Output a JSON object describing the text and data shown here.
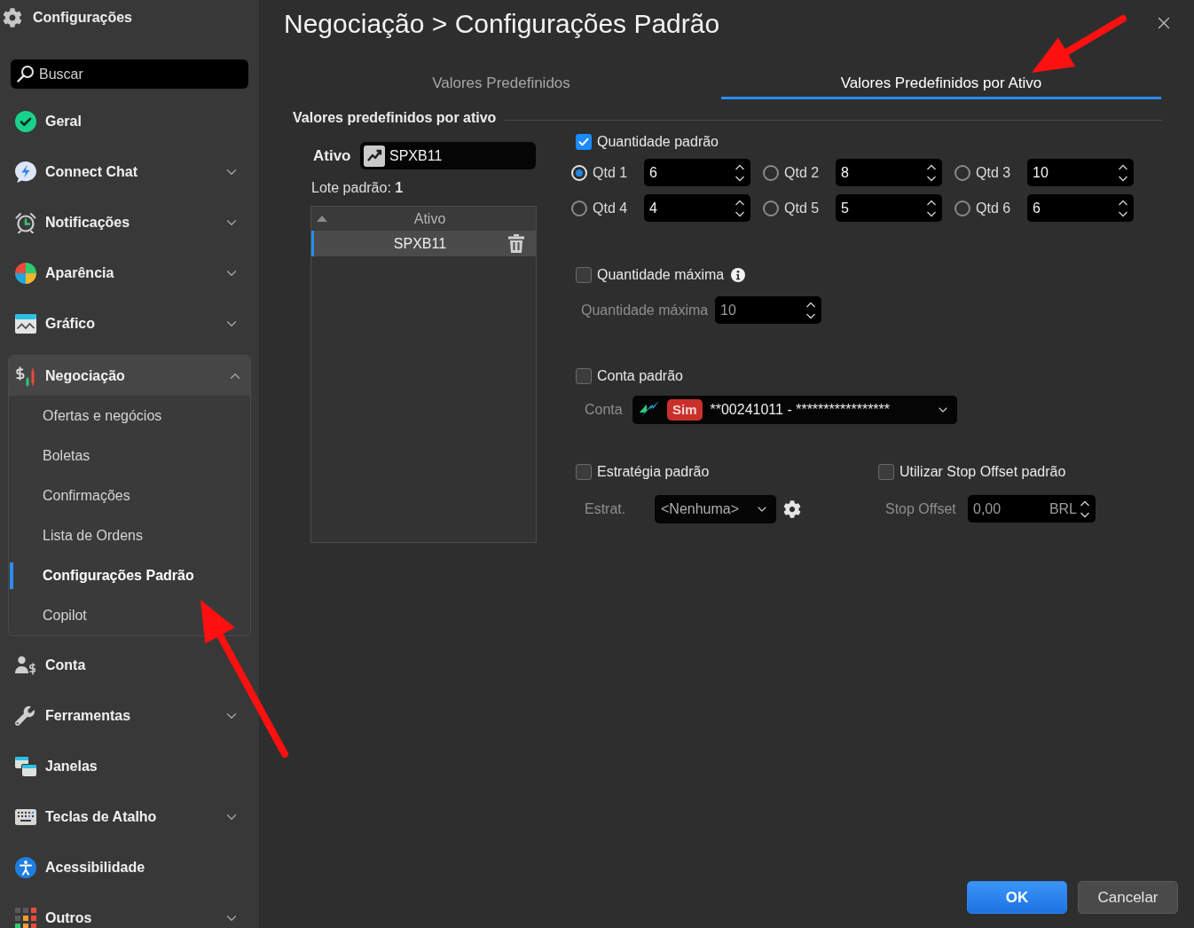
{
  "sidebar": {
    "title": "Configurações",
    "search": {
      "placeholder": "Buscar"
    },
    "items": [
      {
        "label": "Geral",
        "kind": "page",
        "selected": false
      },
      {
        "label": "Connect Chat",
        "kind": "group",
        "expanded": false,
        "selected": false
      },
      {
        "label": "Notificações",
        "kind": "group",
        "expanded": false,
        "selected": false
      },
      {
        "label": "Aparência",
        "kind": "group",
        "expanded": false,
        "selected": false
      },
      {
        "label": "Gráfico",
        "kind": "group",
        "expanded": false,
        "selected": false
      },
      {
        "label": "Negociação",
        "kind": "group",
        "expanded": true,
        "selected": false,
        "children": [
          {
            "label": "Ofertas e negócios",
            "selected": false
          },
          {
            "label": "Boletas",
            "selected": false
          },
          {
            "label": "Confirmações",
            "selected": false
          },
          {
            "label": "Lista de Ordens",
            "selected": false
          },
          {
            "label": "Configurações Padrão",
            "selected": true
          },
          {
            "label": "Copilot",
            "selected": false
          }
        ]
      },
      {
        "label": "Conta",
        "kind": "page",
        "selected": false
      },
      {
        "label": "Ferramentas",
        "kind": "group",
        "expanded": false,
        "selected": false
      },
      {
        "label": "Janelas",
        "kind": "page",
        "selected": false
      },
      {
        "label": "Teclas de Atalho",
        "kind": "group",
        "expanded": false,
        "selected": false
      },
      {
        "label": "Acessibilidade",
        "kind": "page",
        "selected": false
      },
      {
        "label": "Outros",
        "kind": "group",
        "expanded": false,
        "selected": false
      }
    ]
  },
  "title": "Negociação > Configurações Padrão",
  "tabs": [
    {
      "label": "Valores Predefinidos",
      "selected": false
    },
    {
      "label": "Valores Predefinidos por Ativo",
      "selected": true
    }
  ],
  "section": {
    "title": "Valores predefinidos por ativo"
  },
  "asset": {
    "label": "Ativo",
    "value": "SPXB11",
    "lot": "Lote padrão: **1**",
    "list": {
      "column": "Ativo",
      "rows": [
        {
          "symbol": "SPXB11",
          "selected": true
        }
      ]
    }
  },
  "default_quantity": {
    "label": "Quantidade padrão",
    "checked": true,
    "options": [
      {
        "label": "Qtd 1",
        "value": "6",
        "selected": true
      },
      {
        "label": "Qtd 2",
        "value": "8",
        "selected": false
      },
      {
        "label": "Qtd 3",
        "value": "10",
        "selected": false
      },
      {
        "label": "Qtd 4",
        "value": "4",
        "selected": false
      },
      {
        "label": "Qtd 5",
        "value": "5",
        "selected": false
      },
      {
        "label": "Qtd 6",
        "value": "6",
        "selected": false
      }
    ]
  },
  "max_quantity": {
    "label": "Quantidade máxima",
    "checked": false,
    "field_label": "Quantidade máxima",
    "value": "10"
  },
  "default_account": {
    "label": "Conta padrão",
    "checked": false,
    "field_label": "Conta",
    "badge": "Sim",
    "value": "**00241011 - *****************"
  },
  "default_strategy": {
    "label": "Estratégia padrão",
    "checked": false,
    "field_label": "Estrat.",
    "value": "<Nenhuma>"
  },
  "stop_offset": {
    "label": "Utilizar Stop Offset padrão",
    "checked": false,
    "field_label": "Stop Offset",
    "value": "0,00",
    "unit": "BRL"
  },
  "buttons": [
    {
      "label": "OK",
      "kind": "primary"
    },
    {
      "label": "Cancelar",
      "kind": "secondary"
    }
  ],
  "annotations": [
    {
      "kind": "arrow"
    },
    {
      "kind": "arrow"
    }
  ]
}
